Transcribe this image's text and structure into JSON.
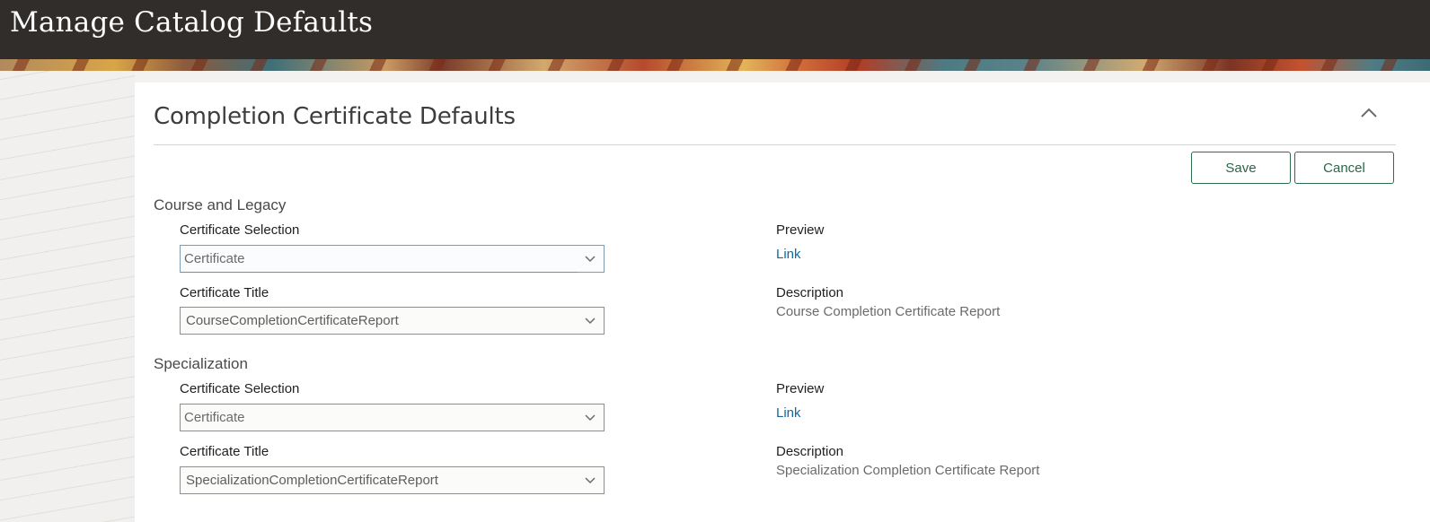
{
  "header": {
    "title": "Manage Catalog Defaults"
  },
  "panel": {
    "title": "Completion Certificate Defaults",
    "collapse_icon": "chevron-up-icon",
    "save_label": "Save",
    "cancel_label": "Cancel"
  },
  "sections": [
    {
      "title": "Course and Legacy",
      "certificate_selection_label": "Certificate Selection",
      "certificate_selection_value": "Certificate",
      "certificate_title_label": "Certificate Title",
      "certificate_title_value": "CourseCompletionCertificateReport",
      "preview_label": "Preview",
      "preview_link": "Link",
      "description_label": "Description",
      "description_value": "Course Completion Certificate Report"
    },
    {
      "title": "Specialization",
      "certificate_selection_label": "Certificate Selection",
      "certificate_selection_value": "Certificate",
      "certificate_title_label": "Certificate Title",
      "certificate_title_value": "SpecializationCompletionCertificateReport",
      "preview_label": "Preview",
      "preview_link": "Link",
      "description_label": "Description",
      "description_value": "Specialization Completion Certificate Report"
    }
  ],
  "colors": {
    "header_bg": "#312d2a",
    "button_accent": "#2c6e4f",
    "link": "#0f6aa0"
  }
}
